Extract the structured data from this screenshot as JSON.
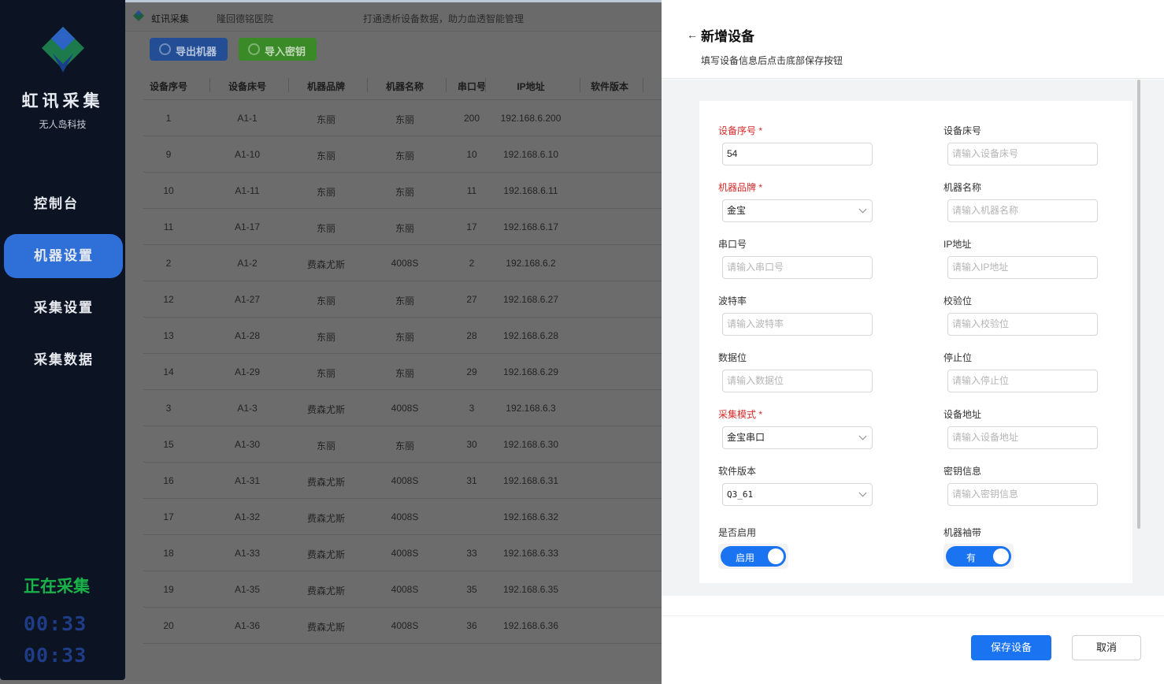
{
  "app": {
    "brand": "虹讯采集",
    "brand_sub": "无人岛科技",
    "hospital": "隆回德铭医院",
    "slogan": "打通透析设备数据，助力血透智能管理"
  },
  "sidebar": {
    "items": [
      {
        "label": "控制台",
        "active": false
      },
      {
        "label": "机器设置",
        "active": true
      },
      {
        "label": "采集设置",
        "active": false
      },
      {
        "label": "采集数据",
        "active": false
      }
    ],
    "status": "正在采集",
    "timer1": "00:33",
    "timer2": "00:33"
  },
  "toolbar": {
    "export_label": "导出机器",
    "import_label": "导入密钥"
  },
  "table": {
    "columns": [
      "设备序号",
      "设备床号",
      "机器品牌",
      "机器名称",
      "串口号",
      "IP地址",
      "软件版本"
    ],
    "rows": [
      [
        "1",
        "A1-1",
        "东丽",
        "东丽",
        "200",
        "192.168.6.200"
      ],
      [
        "9",
        "A1-10",
        "东丽",
        "东丽",
        "10",
        "192.168.6.10"
      ],
      [
        "10",
        "A1-11",
        "东丽",
        "东丽",
        "11",
        "192.168.6.11"
      ],
      [
        "11",
        "A1-17",
        "东丽",
        "东丽",
        "17",
        "192.168.6.17"
      ],
      [
        "2",
        "A1-2",
        "费森尤斯",
        "4008S",
        "2",
        "192.168.6.2"
      ],
      [
        "12",
        "A1-27",
        "东丽",
        "东丽",
        "27",
        "192.168.6.27"
      ],
      [
        "13",
        "A1-28",
        "东丽",
        "东丽",
        "28",
        "192.168.6.28"
      ],
      [
        "14",
        "A1-29",
        "东丽",
        "东丽",
        "29",
        "192.168.6.29"
      ],
      [
        "3",
        "A1-3",
        "费森尤斯",
        "4008S",
        "3",
        "192.168.6.3"
      ],
      [
        "15",
        "A1-30",
        "东丽",
        "东丽",
        "30",
        "192.168.6.30"
      ],
      [
        "16",
        "A1-31",
        "费森尤斯",
        "4008S",
        "31",
        "192.168.6.31"
      ],
      [
        "17",
        "A1-32",
        "费森尤斯",
        "4008S",
        "",
        "192.168.6.32"
      ],
      [
        "18",
        "A1-33",
        "费森尤斯",
        "4008S",
        "33",
        "192.168.6.33"
      ],
      [
        "19",
        "A1-35",
        "费森尤斯",
        "4008S",
        "35",
        "192.168.6.35"
      ],
      [
        "20",
        "A1-36",
        "费森尤斯",
        "4008S",
        "36",
        "192.168.6.36"
      ]
    ]
  },
  "drawer": {
    "title": "新增设备",
    "subtitle": "填写设备信息后点击底部保存按钮",
    "fields": {
      "seq": {
        "label": "设备序号 *",
        "value": "54"
      },
      "bed": {
        "label": "设备床号",
        "placeholder": "请输入设备床号"
      },
      "brand": {
        "label": "机器品牌 *",
        "value": "金宝"
      },
      "name": {
        "label": "机器名称",
        "placeholder": "请输入机器名称"
      },
      "port": {
        "label": "串口号",
        "placeholder": "请输入串口号"
      },
      "ip": {
        "label": "IP地址",
        "placeholder": "请输入IP地址"
      },
      "baud": {
        "label": "波特率",
        "placeholder": "请输入波特率"
      },
      "parity": {
        "label": "校验位",
        "placeholder": "请输入校验位"
      },
      "databits": {
        "label": "数据位",
        "placeholder": "请输入数据位"
      },
      "stopbits": {
        "label": "停止位",
        "placeholder": "请输入停止位"
      },
      "mode": {
        "label": "采集模式 *",
        "value": "金宝串口"
      },
      "address": {
        "label": "设备地址",
        "placeholder": "请输入设备地址"
      },
      "version": {
        "label": "软件版本",
        "value": "Q3_61"
      },
      "key": {
        "label": "密钥信息",
        "placeholder": "请输入密钥信息"
      },
      "enabled": {
        "label": "是否启用",
        "value": "启用"
      },
      "cuff": {
        "label": "机器袖带",
        "value": "有"
      }
    },
    "save_label": "保存设备",
    "cancel_label": "取消"
  },
  "colors": {
    "sidebar_bg": "#0c1322",
    "accent": "#1a73f0",
    "nav_active": "#2f6fd8",
    "status_green": "#19b34a",
    "required_red": "#d42a2a"
  }
}
